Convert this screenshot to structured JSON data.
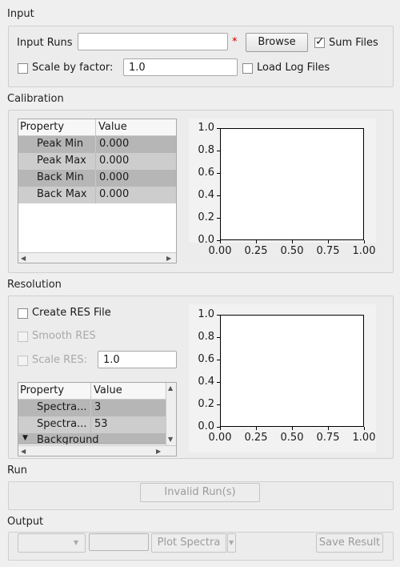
{
  "input": {
    "section_title": "Input",
    "runs_label": "Input Runs",
    "runs_value": "",
    "required_marker": "*",
    "browse_label": "Browse",
    "sum_files_label": "Sum Files",
    "sum_files_checked": true,
    "scale_label": "Scale by factor:",
    "scale_checked": false,
    "scale_value": "1.0",
    "load_log_label": "Load Log Files",
    "load_log_checked": false
  },
  "calibration": {
    "section_title": "Calibration",
    "table_headers": [
      "Property",
      "Value"
    ],
    "rows": [
      {
        "property": "Peak Min",
        "value": "0.000"
      },
      {
        "property": "Peak Max",
        "value": "0.000"
      },
      {
        "property": "Back Min",
        "value": "0.000"
      },
      {
        "property": "Back Max",
        "value": "0.000"
      }
    ],
    "plot": {
      "y_ticks": [
        "0.0",
        "0.2",
        "0.4",
        "0.6",
        "0.8",
        "1.0"
      ],
      "x_ticks": [
        "0.00",
        "0.25",
        "0.50",
        "0.75",
        "1.00"
      ]
    }
  },
  "resolution": {
    "section_title": "Resolution",
    "create_res_label": "Create RES File",
    "create_res_checked": false,
    "smooth_res_label": "Smooth RES",
    "scale_res_label": "Scale RES:",
    "scale_res_value": "1.0",
    "table_headers": [
      "Property",
      "Value"
    ],
    "rows": [
      {
        "property": "Spectra...",
        "value": "3"
      },
      {
        "property": "Spectra...",
        "value": "53"
      },
      {
        "property": "Background",
        "value": ""
      }
    ],
    "plot": {
      "y_ticks": [
        "0.0",
        "0.2",
        "0.4",
        "0.6",
        "0.8",
        "1.0"
      ],
      "x_ticks": [
        "0.00",
        "0.25",
        "0.50",
        "0.75",
        "1.00"
      ]
    }
  },
  "run": {
    "section_title": "Run",
    "button_label": "Invalid Run(s)"
  },
  "output": {
    "section_title": "Output",
    "combo_value": "",
    "second_value": "",
    "plot_spectra_label": "Plot Spectra",
    "save_result_label": "Save Result"
  },
  "colors": {
    "row_dark": "#b6b6b6",
    "row_light": "#cdcdcd",
    "required": "#cc0000"
  },
  "icons": {
    "scroll_left": "scroll-left-icon",
    "scroll_right": "scroll-right-icon",
    "scroll_up": "scroll-up-icon",
    "scroll_down": "scroll-down-icon",
    "expand": "expand-triangle-icon",
    "dropdown": "chevron-down-icon"
  }
}
